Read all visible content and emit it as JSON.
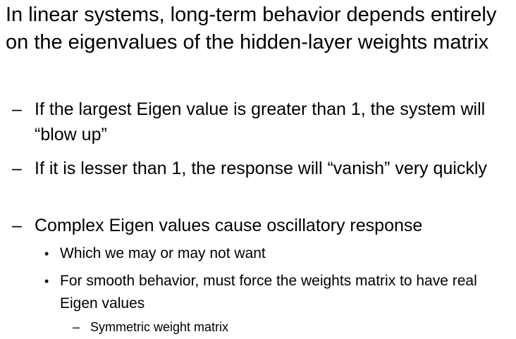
{
  "slide": {
    "point_1": "In linear systems, long-term behavior depends entirely on the eigenvalues of the hidden-layer weights matrix",
    "sub_points": [
      {
        "marker": "–",
        "text": "If the largest Eigen value is greater than 1, the system will “blow up”"
      },
      {
        "marker": "–",
        "text": "If it is lesser than 1, the response will “vanish” very quickly"
      },
      {
        "marker": "–",
        "text": "Complex Eigen values cause oscillatory response"
      }
    ],
    "sub_sub_points": [
      {
        "marker": "•",
        "text": "Which we may or may not want"
      },
      {
        "marker": "•",
        "text": "For smooth behavior, must force the weights matrix to have real Eigen values"
      }
    ],
    "level_4_points": [
      {
        "marker": "–",
        "text": "Symmetric weight matrix"
      }
    ]
  }
}
